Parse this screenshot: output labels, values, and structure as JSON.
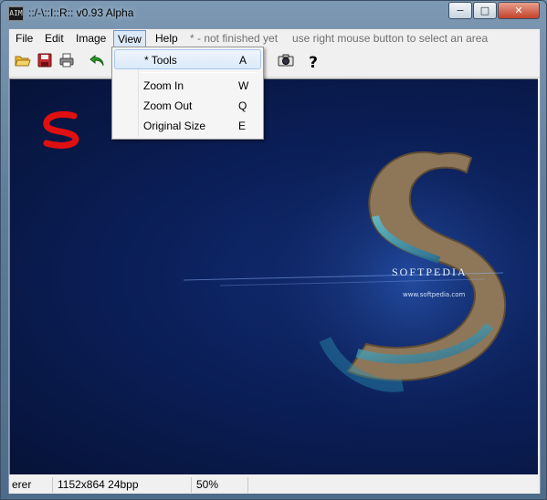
{
  "window": {
    "title": "::/-\\::I::R:: v0.93 Alpha",
    "app_icon": "AIM",
    "controls": {
      "minimize": "−",
      "maximize": "□",
      "close": "✕"
    }
  },
  "menubar": {
    "file": "File",
    "edit": "Edit",
    "image": "Image",
    "view": "View",
    "help": "Help",
    "hint1": "* - not finished yet",
    "hint2": "use right mouse button to select an area"
  },
  "toolbar": {
    "icons": [
      "open-folder-icon",
      "save-icon",
      "print-icon",
      "undo-icon",
      "camera-icon",
      "help-icon"
    ],
    "help_glyph": "?"
  },
  "view_menu": {
    "items": [
      {
        "label": "* Tools",
        "shortcut": "A"
      },
      {
        "label": "Zoom In",
        "shortcut": "W"
      },
      {
        "label": "Zoom Out",
        "shortcut": "Q"
      },
      {
        "label": "Original Size",
        "shortcut": "E"
      }
    ]
  },
  "image": {
    "watermark": "SOFTPEDIA",
    "url": "www.softpedia.com",
    "logo_letter": "S",
    "colors": {
      "ocean_deep": "#061338",
      "ocean": "#14317a",
      "land": "#a08a6a",
      "reef": "#3fa0b8",
      "accent_red": "#e01010"
    }
  },
  "statusbar": {
    "cell1": "erer",
    "cell2": "1152x864 24bpp",
    "cell3": "50%"
  }
}
